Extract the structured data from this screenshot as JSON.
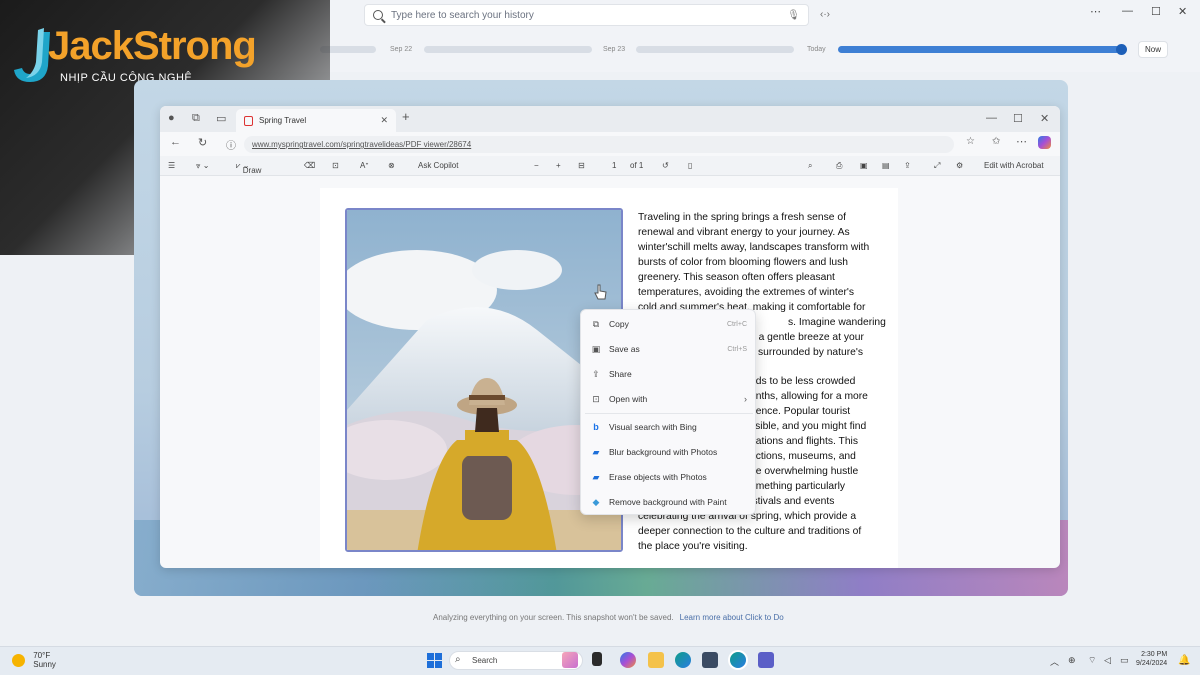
{
  "recall": {
    "search_placeholder": "Type here to search your history",
    "timeline": {
      "label_1": "Sep 22",
      "label_2": "Sep 23",
      "label_3": "Today",
      "now_button": "Now"
    }
  },
  "logo": {
    "brand": "JackStrong",
    "tagline": "NHỊP CẦU CÔNG NGHỆ"
  },
  "browser": {
    "tab_title": "Spring Travel",
    "url": "www.myspringtravel.com/springtravelideas/PDF viewer/28674",
    "pdf_toolbar": {
      "draw": "Draw",
      "ask_copilot": "Ask Copilot",
      "page_current": "1",
      "page_total": "of 1",
      "edit_acrobat": "Edit with Acrobat"
    }
  },
  "document": {
    "paragraph_1_lines": [
      "Traveling in the spring brings a fresh sense of",
      "renewal and vibrant energy to your journey. As",
      "winter'schill melts away, landscapes transform with",
      "bursts of color from blooming flowers and lush",
      "greenery. This season often offers pleasant",
      "temperatures, avoiding the extremes of winter's",
      "cold and summer's heat, making it comfortable for",
      "s. Imagine wandering",
      "h a gentle breeze at your",
      "s surrounded by nature's"
    ],
    "paragraph_2_lines": [
      "nds to be less crowded",
      "onths, allowing for a more",
      "rience. Popular tourist",
      "ssible, and you might find",
      "dations and flights. This",
      "actions, museums, and",
      "he overwhelming hustle",
      "omething particularly",
      "enchanting about local festivals and events",
      "celebrating the arrival of spring, which provide a",
      "deeper connection to the culture and traditions of",
      "the place you're visiting."
    ]
  },
  "context_menu": {
    "copy": "Copy",
    "copy_shortcut": "Ctrl+C",
    "save_as": "Save as",
    "save_shortcut": "Ctrl+S",
    "share": "Share",
    "open_with": "Open with",
    "visual_search": "Visual search with Bing",
    "blur_bg": "Blur background with Photos",
    "erase_objects": "Erase objects with Photos",
    "remove_bg": "Remove background with Paint"
  },
  "caption": {
    "text": "Analyzing everything on your screen. This snapshot won't be saved.",
    "link": "Learn more about Click to Do"
  },
  "taskbar": {
    "weather_temp": "70°F",
    "weather_desc": "Sunny",
    "search": "Search",
    "time": "2:30 PM",
    "date": "9/24/2024"
  }
}
